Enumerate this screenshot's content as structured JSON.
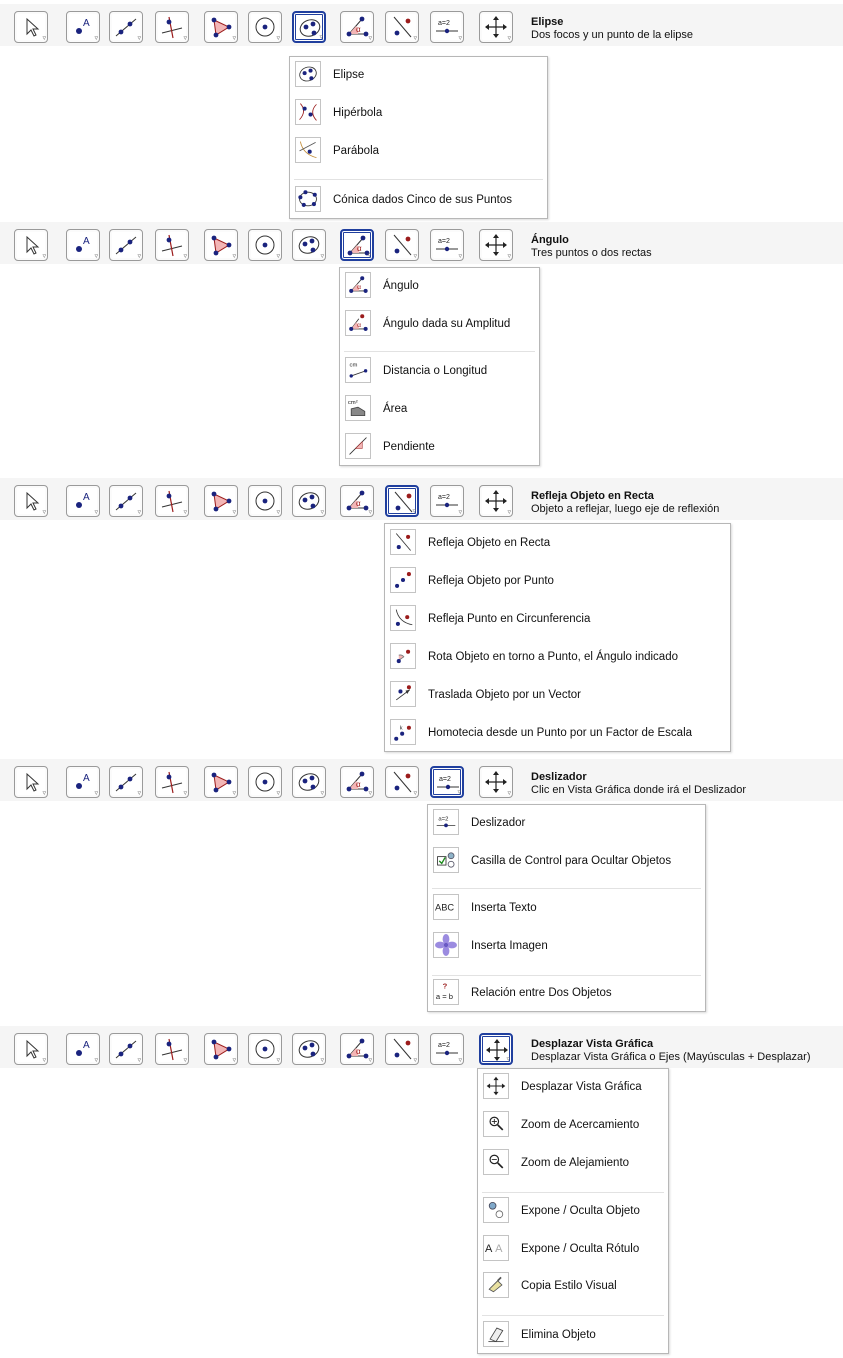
{
  "colors": {
    "active_border": "#203f9e",
    "point": "#1a237e",
    "accent_red": "#9b1c1c",
    "fill_pink": "#f3b6b6"
  },
  "toolbar_icons": [
    "cursor-icon",
    "point-icon",
    "line-icon",
    "perpendicular-icon",
    "polygon-icon",
    "circle-icon",
    "ellipse-icon",
    "angle-icon",
    "reflect-icon",
    "slider-icon",
    "move-view-icon"
  ],
  "slider_icon_text": "a=2",
  "panels": [
    {
      "active_tool": 6,
      "title": "Elipse",
      "subtitle": "Dos focos y un punto de la elipse",
      "menu_items": [
        {
          "label": "Elipse",
          "icon": "ellipse-icon"
        },
        {
          "label": "Hipérbola",
          "icon": "hyperbola-icon"
        },
        {
          "label": "Parábola",
          "icon": "parabola-icon"
        },
        {
          "label": "Cónica dados Cinco de sus Puntos",
          "icon": "conic-five-points-icon"
        }
      ]
    },
    {
      "active_tool": 7,
      "title": "Ángulo",
      "subtitle": "Tres puntos o dos rectas",
      "menu_items": [
        {
          "label": "Ángulo",
          "icon": "angle-icon"
        },
        {
          "label": "Ángulo dada su Amplitud",
          "icon": "angle-fixed-icon"
        },
        {
          "label": "Distancia o Longitud",
          "icon": "distance-icon"
        },
        {
          "label": "Área",
          "icon": "area-icon"
        },
        {
          "label": "Pendiente",
          "icon": "slope-icon"
        }
      ]
    },
    {
      "active_tool": 8,
      "title": "Refleja Objeto en Recta",
      "subtitle": "Objeto a reflejar, luego eje de reflexión",
      "menu_items": [
        {
          "label": "Refleja Objeto en Recta",
          "icon": "reflect-line-icon"
        },
        {
          "label": "Refleja Objeto por Punto",
          "icon": "reflect-point-icon"
        },
        {
          "label": "Refleja Punto en Circunferencia",
          "icon": "reflect-circle-icon"
        },
        {
          "label": "Rota Objeto en torno a Punto, el Ángulo indicado",
          "icon": "rotate-icon"
        },
        {
          "label": "Traslada Objeto por un Vector",
          "icon": "translate-icon"
        },
        {
          "label": "Homotecia desde un Punto por un Factor de Escala",
          "icon": "dilate-icon"
        }
      ]
    },
    {
      "active_tool": 9,
      "title": "Deslizador",
      "subtitle": "Clic en Vista Gráfica donde irá el Deslizador",
      "menu_items": [
        {
          "label": "Deslizador",
          "icon": "slider-icon"
        },
        {
          "label": "Casilla de Control para Ocultar Objetos",
          "icon": "checkbox-icon"
        },
        {
          "label": "Inserta Texto",
          "icon": "text-icon"
        },
        {
          "label": "Inserta Imagen",
          "icon": "image-icon"
        },
        {
          "label": "Relación entre Dos Objetos",
          "icon": "relation-icon"
        }
      ]
    },
    {
      "active_tool": 10,
      "title": "Desplazar Vista Gráfica",
      "subtitle": "Desplazar Vista Gráfica o Ejes (Mayúsculas + Desplazar)",
      "menu_items": [
        {
          "label": "Desplazar Vista Gráfica",
          "icon": "move-view-icon"
        },
        {
          "label": "Zoom de Acercamiento",
          "icon": "zoom-in-icon"
        },
        {
          "label": "Zoom de Alejamiento",
          "icon": "zoom-out-icon"
        },
        {
          "label": "Expone / Oculta Objeto",
          "icon": "show-hide-object-icon"
        },
        {
          "label": "Expone / Oculta Rótulo",
          "icon": "show-hide-label-icon"
        },
        {
          "label": "Copia Estilo Visual",
          "icon": "copy-style-icon"
        },
        {
          "label": "Elimina Objeto",
          "icon": "delete-icon"
        }
      ]
    }
  ]
}
